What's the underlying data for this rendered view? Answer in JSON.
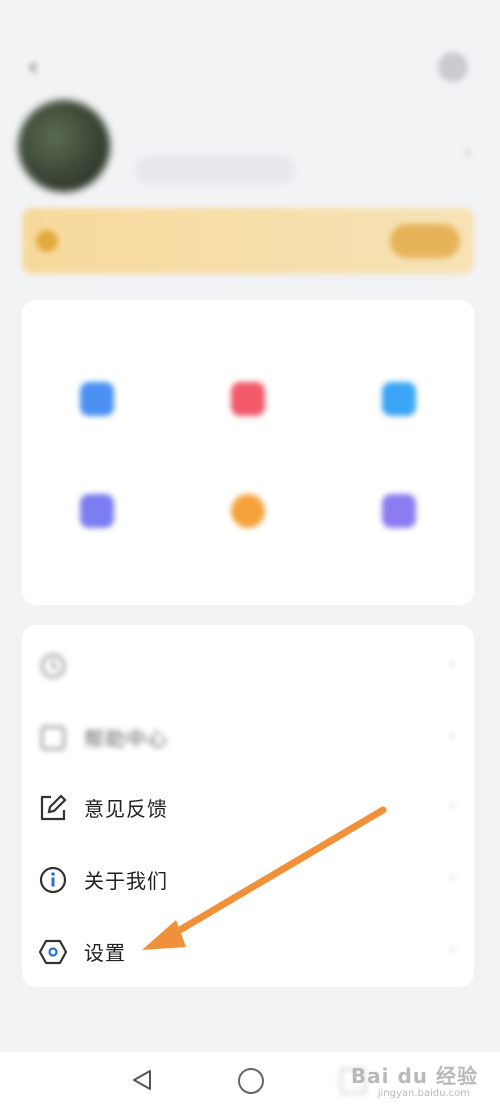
{
  "status_bar": {
    "left": "",
    "right": ""
  },
  "profile": {
    "username": "",
    "tag": ""
  },
  "vip": {
    "text1": "",
    "text2": "",
    "button": ""
  },
  "tools": {
    "title": "",
    "items": [
      {
        "label": "",
        "color": "#4a90f2"
      },
      {
        "label": "",
        "color": "#f25a6a"
      },
      {
        "label": "",
        "color": "#3aa6f5"
      },
      {
        "label": "",
        "color": "#7b7ef0"
      },
      {
        "label": "",
        "color": "#f5a23a"
      },
      {
        "label": "",
        "color": "#8c7cf2"
      }
    ]
  },
  "menu": {
    "items": [
      {
        "label": "",
        "icon": "clock-icon"
      },
      {
        "label": "帮助中心",
        "icon": "help-icon"
      },
      {
        "label": "意见反馈",
        "icon": "edit-icon"
      },
      {
        "label": "关于我们",
        "icon": "info-icon"
      },
      {
        "label": "设置",
        "icon": "settings-hexagon-icon"
      }
    ]
  },
  "watermark": {
    "logo": "Bai du 经验",
    "sub": "jingyan.baidu.com"
  },
  "colors": {
    "annotation_arrow": "#f0913a",
    "vip_bg": "#f7d99c"
  }
}
